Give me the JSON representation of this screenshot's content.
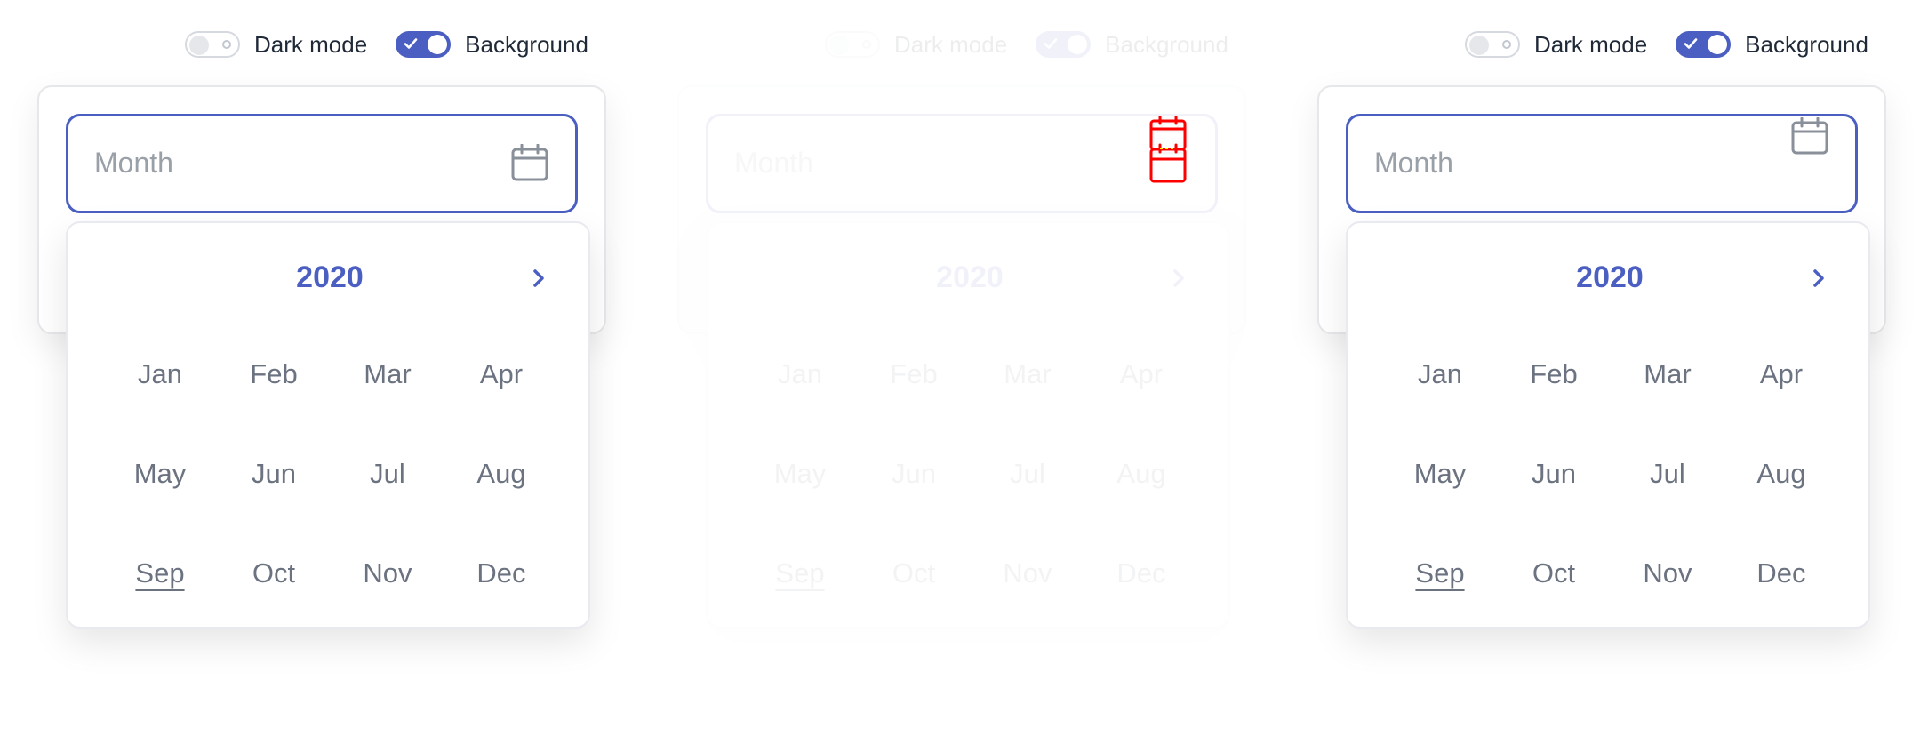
{
  "colors": {
    "accent": "#4a5fc1",
    "overlay_icon": "#ff0000",
    "highlight": "#ffff00"
  },
  "panels": [
    {
      "toggles": {
        "dark_mode": {
          "label": "Dark mode",
          "on": false
        },
        "background": {
          "label": "Background",
          "on": true
        }
      },
      "input": {
        "placeholder": "Month",
        "icon": "calendar-icon"
      },
      "picker": {
        "year": "2020",
        "next_icon": "chevron-right-icon",
        "months": [
          "Jan",
          "Feb",
          "Mar",
          "Apr",
          "May",
          "Jun",
          "Jul",
          "Aug",
          "Sep",
          "Oct",
          "Nov",
          "Dec"
        ],
        "current_month": "Sep"
      }
    },
    {
      "toggles": {
        "dark_mode": {
          "label": "Dark mode",
          "on": false
        },
        "background": {
          "label": "Background",
          "on": true
        }
      },
      "input": {
        "placeholder": "Month",
        "icon": "calendar-icon"
      },
      "picker": {
        "year": "2020",
        "next_icon": "chevron-right-icon",
        "months": [
          "Jan",
          "Feb",
          "Mar",
          "Apr",
          "May",
          "Jun",
          "Jul",
          "Aug",
          "Sep",
          "Oct",
          "Nov",
          "Dec"
        ],
        "current_month": "Sep"
      }
    },
    {
      "toggles": {
        "dark_mode": {
          "label": "Dark mode",
          "on": false
        },
        "background": {
          "label": "Background",
          "on": true
        }
      },
      "input": {
        "placeholder": "Month",
        "icon": "calendar-icon"
      },
      "picker": {
        "year": "2020",
        "next_icon": "chevron-right-icon",
        "months": [
          "Jan",
          "Feb",
          "Mar",
          "Apr",
          "May",
          "Jun",
          "Jul",
          "Aug",
          "Sep",
          "Oct",
          "Nov",
          "Dec"
        ],
        "current_month": "Sep"
      }
    }
  ]
}
